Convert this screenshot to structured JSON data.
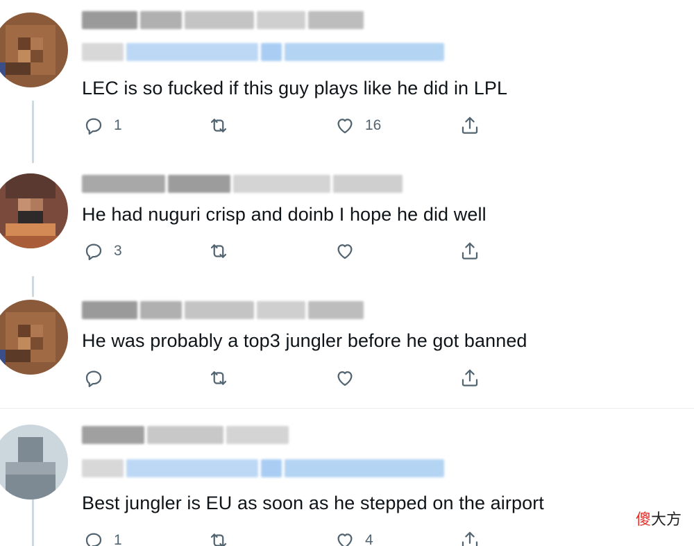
{
  "replies": [
    {
      "text": "LEC is so fucked if this guy plays like he did in LPL",
      "reply_count": "1",
      "retweet_count": "",
      "like_count": "16"
    },
    {
      "text": "He had nuguri crisp and doinb I hope he did well",
      "reply_count": "3",
      "retweet_count": "",
      "like_count": ""
    },
    {
      "text": "He was probably a top3 jungler before he got banned",
      "reply_count": "",
      "retweet_count": "",
      "like_count": ""
    },
    {
      "text": "Best jungler is EU as soon as he stepped on the airport",
      "reply_count": "1",
      "retweet_count": "",
      "like_count": "4"
    }
  ],
  "icons": {
    "reply": "reply-icon",
    "retweet": "retweet-icon",
    "like": "heart-icon",
    "share": "share-icon"
  },
  "colors": {
    "text": "#0f1419",
    "muted": "#536471",
    "thread_line": "#cfd9de",
    "link_blur": "#a9cdf3"
  },
  "watermark": {
    "part1": "傻",
    "part2": "大方"
  }
}
